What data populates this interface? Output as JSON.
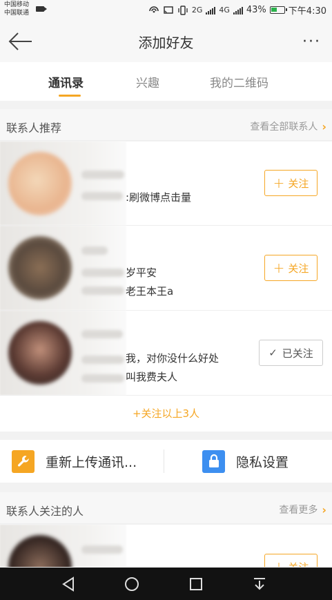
{
  "status_bar": {
    "carrier_1": "中国移动",
    "carrier_2": "中国联通",
    "battery": "43%",
    "time": "下午4:30",
    "net_1": "2G",
    "net_2": "4G"
  },
  "nav": {
    "title": "添加好友",
    "back_icon": "back-arrow-icon",
    "more_icon": "more-dots-icon",
    "more_glyph": "···"
  },
  "tabs": [
    {
      "label": "通讯录",
      "active": true
    },
    {
      "label": "兴趣",
      "active": false
    },
    {
      "label": "我的二维码",
      "active": false
    }
  ],
  "contacts_section": {
    "title": "联系人推荐",
    "link": "查看全部联系人",
    "chevron": "›"
  },
  "contacts": [
    {
      "line1": ":刷微博点击量",
      "button_plus": "+",
      "button": "关注",
      "followed": false
    },
    {
      "line1": "岁平安",
      "line2": "老王本王a",
      "button_plus": "+",
      "button": "关注",
      "followed": false
    },
    {
      "line1": "我，对你没什么好处",
      "line2": "叫我费夫人",
      "button_check": "✓",
      "button": "已关注",
      "followed": true
    }
  ],
  "follow_all": "+关注以上3人",
  "actions": [
    {
      "label": "重新上传通讯...",
      "icon": "wrench-icon",
      "color": "#f5a623"
    },
    {
      "label": "隐私设置",
      "icon": "lock-icon",
      "color": "#3d8ff0"
    }
  ],
  "followed_section": {
    "title": "联系人关注的人",
    "link": "查看更多",
    "chevron": "›"
  },
  "followed_preview": {
    "button_plus": "+",
    "button": "关注"
  },
  "colors": {
    "accent": "#f5a623",
    "privacy_blue": "#3d8ff0"
  },
  "system_nav": [
    "back-triangle-icon",
    "home-circle-icon",
    "recents-square-icon",
    "notification-pull-icon"
  ]
}
